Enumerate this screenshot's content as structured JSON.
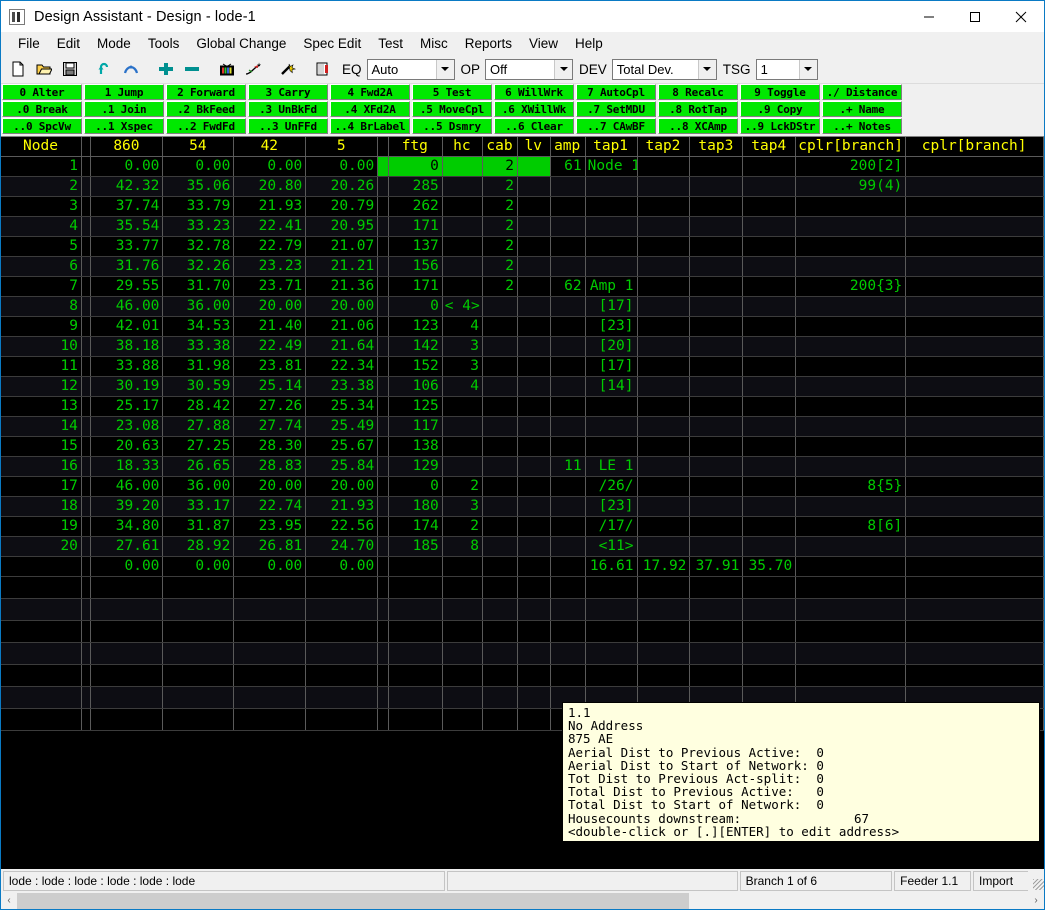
{
  "window": {
    "title": "Design Assistant - Design - lode-1",
    "icon": "app-icon",
    "minimize": "—",
    "maximize": "□",
    "close": "✕"
  },
  "menubar": {
    "items": [
      "File",
      "Edit",
      "Mode",
      "Tools",
      "Global Change",
      "Spec Edit",
      "Test",
      "Misc",
      "Reports",
      "View",
      "Help"
    ]
  },
  "toolbar": {
    "icons": [
      "new-document-icon",
      "open-folder-icon",
      "save-disk-icon",
      "undo-icon",
      "redo-icon",
      "add-plus-icon",
      "remove-minus-icon",
      "tv-monitor-icon",
      "trace-path-icon",
      "magic-wand-icon",
      "book-icon"
    ],
    "eq_label": "EQ",
    "eq_value": "Auto",
    "op_label": "OP",
    "op_value": "Off",
    "dev_label": "DEV",
    "dev_value": "Total Dev.",
    "tsg_label": "TSG",
    "tsg_value": "1"
  },
  "function_keys": {
    "row1": [
      "0 Alter",
      "1 Jump",
      "2 Forward",
      "3 Carry",
      "4 Fwd2A",
      "5 Test",
      "6 WillWrk",
      "7 AutoCpl",
      "8 Recalc",
      "9 Toggle",
      "./ Distance"
    ],
    "row2": [
      ".0 Break",
      ".1 Join",
      ".2 BkFeed",
      ".3 UnBkFd",
      ".4 XFd2A",
      ".5 MoveCpl",
      ".6 XWillWk",
      ".7 SetMDU",
      ".8 RotTap",
      ".9 Copy",
      ".+ Name"
    ],
    "row3": [
      "..0 SpcVw",
      "..1 Xspec",
      "..2 FwdFd",
      "..3 UnFFd",
      "..4 BrLabel",
      "..5 Dsmry",
      "..6 Clear",
      "..7 CAwBF",
      "..8 XCAmp",
      "..9 LckDStr",
      "..+ Notes"
    ]
  },
  "grid": {
    "headers": [
      "Node",
      "",
      "860",
      "54",
      "42",
      "5",
      "",
      "ftg",
      "hc",
      "cab",
      "lv",
      "amp",
      "tap1",
      "tap2",
      "tap3",
      "tap4",
      "cplr[branch]",
      "cplr[branch]"
    ],
    "rows": [
      {
        "node": "1",
        "c860": "0.00",
        "c54": "0.00",
        "c42": "0.00",
        "c5": "0.00",
        "ftg": "0",
        "hc": "",
        "cab": "2",
        "lv": "",
        "amp": "61",
        "tap1": "Node 1",
        "tap2": "",
        "tap3": "",
        "tap4": "",
        "cplr1": "200[2]",
        "cplr2": "",
        "selected": true,
        "tap1_style": "white"
      },
      {
        "node": "2",
        "c860": "42.32",
        "c54": "35.06",
        "c42": "20.80",
        "c5": "20.26",
        "ftg": "285",
        "hc": "",
        "cab": "2",
        "lv": "",
        "amp": "",
        "tap1": "",
        "tap2": "",
        "tap3": "",
        "tap4": "",
        "cplr1": "99(4)",
        "cplr2": ""
      },
      {
        "node": "3",
        "c860": "37.74",
        "c54": "33.79",
        "c42": "21.93",
        "c5": "20.79",
        "ftg": "262",
        "hc": "",
        "cab": "2",
        "lv": "",
        "amp": "",
        "tap1": "",
        "tap2": "",
        "tap3": "",
        "tap4": "",
        "cplr1": "",
        "cplr2": ""
      },
      {
        "node": "4",
        "c860": "35.54",
        "c54": "33.23",
        "c42": "22.41",
        "c5": "20.95",
        "ftg": "171",
        "hc": "",
        "cab": "2",
        "lv": "",
        "amp": "",
        "tap1": "",
        "tap2": "",
        "tap3": "",
        "tap4": "",
        "cplr1": "",
        "cplr2": ""
      },
      {
        "node": "5",
        "c860": "33.77",
        "c54": "32.78",
        "c42": "22.79",
        "c5": "21.07",
        "ftg": "137",
        "hc": "",
        "cab": "2",
        "lv": "",
        "amp": "",
        "tap1": "",
        "tap2": "",
        "tap3": "",
        "tap4": "",
        "cplr1": "",
        "cplr2": ""
      },
      {
        "node": "6",
        "c860": "31.76",
        "c54": "32.26",
        "c42": "23.23",
        "c5": "21.21",
        "ftg": "156",
        "hc": "",
        "cab": "2",
        "lv": "",
        "amp": "",
        "tap1": "",
        "tap2": "",
        "tap3": "",
        "tap4": "",
        "cplr1": "",
        "cplr2": ""
      },
      {
        "node": "7",
        "c860": "29.55",
        "c54": "31.70",
        "c42": "23.71",
        "c5": "21.36",
        "ftg": "171",
        "hc": "",
        "cab": "2",
        "lv": "",
        "amp": "62",
        "tap1": "Amp 1",
        "tap2": "",
        "tap3": "",
        "tap4": "",
        "cplr1": "200{3}",
        "cplr2": "",
        "tap1_style": "white"
      },
      {
        "node": "8",
        "c860": "46.00",
        "c54": "36.00",
        "c42": "20.00",
        "c5": "20.00",
        "ftg": "0",
        "hc": "< 4>",
        "cab": "",
        "lv": "",
        "amp": "",
        "tap1": "[17]",
        "tap2": "",
        "tap3": "",
        "tap4": "",
        "cplr1": "",
        "cplr2": ""
      },
      {
        "node": "9",
        "c860": "42.01",
        "c54": "34.53",
        "c42": "21.40",
        "c5": "21.06",
        "ftg": "123",
        "hc": "4",
        "cab": "",
        "lv": "",
        "amp": "",
        "tap1": "[23]",
        "tap2": "",
        "tap3": "",
        "tap4": "",
        "cplr1": "",
        "cplr2": ""
      },
      {
        "node": "10",
        "c860": "38.18",
        "c54": "33.38",
        "c42": "22.49",
        "c5": "21.64",
        "ftg": "142",
        "hc": "3",
        "cab": "",
        "lv": "",
        "amp": "",
        "tap1": "[20]",
        "tap2": "",
        "tap3": "",
        "tap4": "",
        "cplr1": "",
        "cplr2": ""
      },
      {
        "node": "11",
        "c860": "33.88",
        "c54": "31.98",
        "c42": "23.81",
        "c5": "22.34",
        "ftg": "152",
        "hc": "3",
        "cab": "",
        "lv": "",
        "amp": "",
        "tap1": "[17]",
        "tap2": "",
        "tap3": "",
        "tap4": "",
        "cplr1": "",
        "cplr2": ""
      },
      {
        "node": "12",
        "c860": "30.19",
        "c54": "30.59",
        "c42": "25.14",
        "c5": "23.38",
        "ftg": "106",
        "hc": "4",
        "cab": "",
        "lv": "",
        "amp": "",
        "tap1": "[14]",
        "tap2": "",
        "tap3": "",
        "tap4": "",
        "cplr1": "",
        "cplr2": "",
        "tap1_style": "yellow"
      },
      {
        "node": "13",
        "c860": "25.17",
        "c54": "28.42",
        "c42": "27.26",
        "c5": "25.34",
        "ftg": "125",
        "hc": "",
        "cab": "",
        "lv": "",
        "amp": "",
        "tap1": "",
        "tap2": "",
        "tap3": "",
        "tap4": "",
        "cplr1": "",
        "cplr2": ""
      },
      {
        "node": "14",
        "c860": "23.08",
        "c54": "27.88",
        "c42": "27.74",
        "c5": "25.49",
        "ftg": "117",
        "hc": "",
        "cab": "",
        "lv": "",
        "amp": "",
        "tap1": "",
        "tap2": "",
        "tap3": "",
        "tap4": "",
        "cplr1": "",
        "cplr2": ""
      },
      {
        "node": "15",
        "c860": "20.63",
        "c54": "27.25",
        "c42": "28.30",
        "c5": "25.67",
        "ftg": "138",
        "hc": "",
        "cab": "",
        "lv": "",
        "amp": "",
        "tap1": "",
        "tap2": "",
        "tap3": "",
        "tap4": "",
        "cplr1": "",
        "cplr2": ""
      },
      {
        "node": "16",
        "c860": "18.33",
        "c54": "26.65",
        "c42": "28.83",
        "c5": "25.84",
        "ftg": "129",
        "hc": "",
        "cab": "",
        "lv": "",
        "amp": "11",
        "tap1": "LE 1",
        "tap2": "",
        "tap3": "",
        "tap4": "",
        "cplr1": "",
        "cplr2": "",
        "tap1_style": "white"
      },
      {
        "node": "17",
        "c860": "46.00",
        "c54": "36.00",
        "c42": "20.00",
        "c5": "20.00",
        "ftg": "0",
        "hc": "2",
        "cab": "",
        "lv": "",
        "amp": "",
        "tap1": "/26/",
        "tap2": "",
        "tap3": "",
        "tap4": "",
        "cplr1": "8{5}",
        "cplr2": ""
      },
      {
        "node": "18",
        "c860": "39.20",
        "c54": "33.17",
        "c42": "22.74",
        "c5": "21.93",
        "ftg": "180",
        "hc": "3",
        "cab": "",
        "lv": "",
        "amp": "",
        "tap1": "[23]",
        "tap2": "",
        "tap3": "",
        "tap4": "",
        "cplr1": "",
        "cplr2": ""
      },
      {
        "node": "19",
        "c860": "34.80",
        "c54": "31.87",
        "c42": "23.95",
        "c5": "22.56",
        "ftg": "174",
        "hc": "2",
        "cab": "",
        "lv": "",
        "amp": "",
        "tap1": "/17/",
        "tap2": "",
        "tap3": "",
        "tap4": "",
        "cplr1": "8[6]",
        "cplr2": ""
      },
      {
        "node": "20",
        "c860": "27.61",
        "c54": "28.92",
        "c42": "26.81",
        "c5": "24.70",
        "ftg": "185",
        "hc": "8",
        "cab": "",
        "lv": "",
        "amp": "",
        "tap1": "<11>",
        "tap2": "",
        "tap3": "",
        "tap4": "",
        "cplr1": "",
        "cplr2": "",
        "tap1_style": "yellow"
      },
      {
        "node": "",
        "c860": "0.00",
        "c54": "0.00",
        "c42": "0.00",
        "c5": "0.00",
        "ftg": "",
        "hc": "",
        "cab": "",
        "lv": "",
        "amp": "",
        "tap1": "16.61",
        "tap2": "17.92",
        "tap3": "37.91",
        "tap4": "35.70",
        "cplr1": "",
        "cplr2": "",
        "tap1_style": "yellow",
        "tap2_style": "yellow"
      }
    ]
  },
  "info_panel": {
    "lines": [
      "1.1",
      "No Address",
      "875 AE",
      "Aerial Dist to Previous Active:  0",
      "Aerial Dist to Start of Network: 0",
      "Tot Dist to Previous Act-split:  0",
      "Total Dist to Previous Active:   0",
      "Total Dist to Start of Network:  0",
      "Housecounts downstream:               67",
      "<double-click or [.][ENTER] to edit address>"
    ]
  },
  "statusbar": {
    "path": "lode : lode : lode : lode : lode : lode",
    "empty": "",
    "branch": "Branch 1 of 6",
    "feeder": "Feeder 1.1",
    "import": "Import"
  },
  "scrollbar": {
    "left_arrow": "‹",
    "right_arrow": "›"
  },
  "colors": {
    "grid_bg": "#000000",
    "grid_text": "#00cc00",
    "grid_header_text": "#ffff00",
    "selection": "#00cc00",
    "fkey_bg": "#00e800",
    "info_bg": "#ffffe0",
    "titlebar_border": "#0a7ac4"
  }
}
